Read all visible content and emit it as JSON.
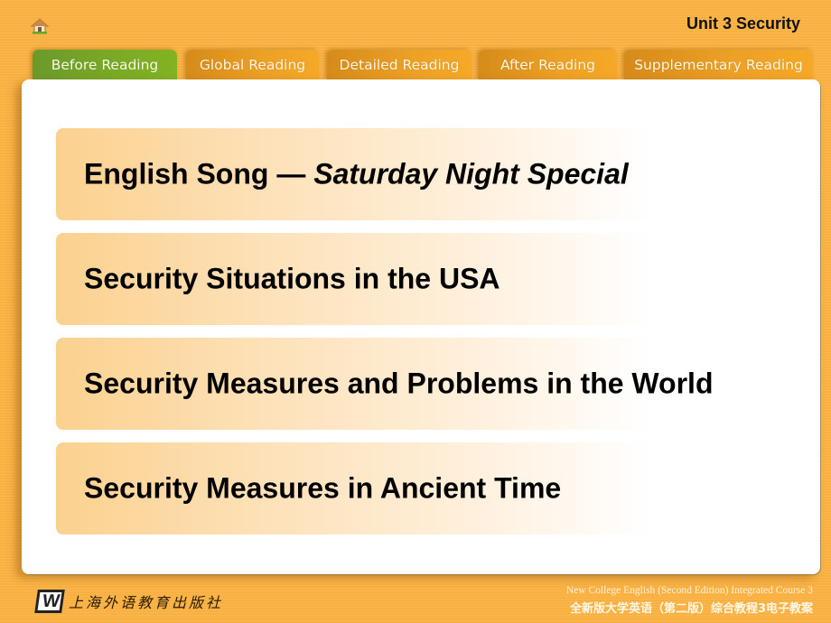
{
  "header": {
    "home_icon": "home-icon",
    "unit_title": "Unit 3 Security"
  },
  "tabs": [
    {
      "label": "Before Reading",
      "active": true
    },
    {
      "label": "Global Reading",
      "active": false
    },
    {
      "label": "Detailed Reading",
      "active": false
    },
    {
      "label": "After Reading",
      "active": false
    },
    {
      "label": "Supplementary Reading",
      "active": false
    }
  ],
  "items": [
    {
      "label": "English Song — ",
      "italic": "Saturday Night Special"
    },
    {
      "label": "Security Situations in the USA"
    },
    {
      "label": "Security Measures and Problems in the World"
    },
    {
      "label": "Security Measures in Ancient Time"
    }
  ],
  "footer": {
    "logo_letter": "W",
    "publisher": "上海外语教育出版社",
    "course_en": "New College English (Second Edition) Integrated Course 3",
    "course_cn": "全新版大学英语（第二版）综合教程3电子教案"
  },
  "colors": {
    "background": "#fbb342",
    "tab_active": "#7aab25",
    "tab_inactive": "#eda125",
    "item_gradient_start": "#fbd18f"
  }
}
